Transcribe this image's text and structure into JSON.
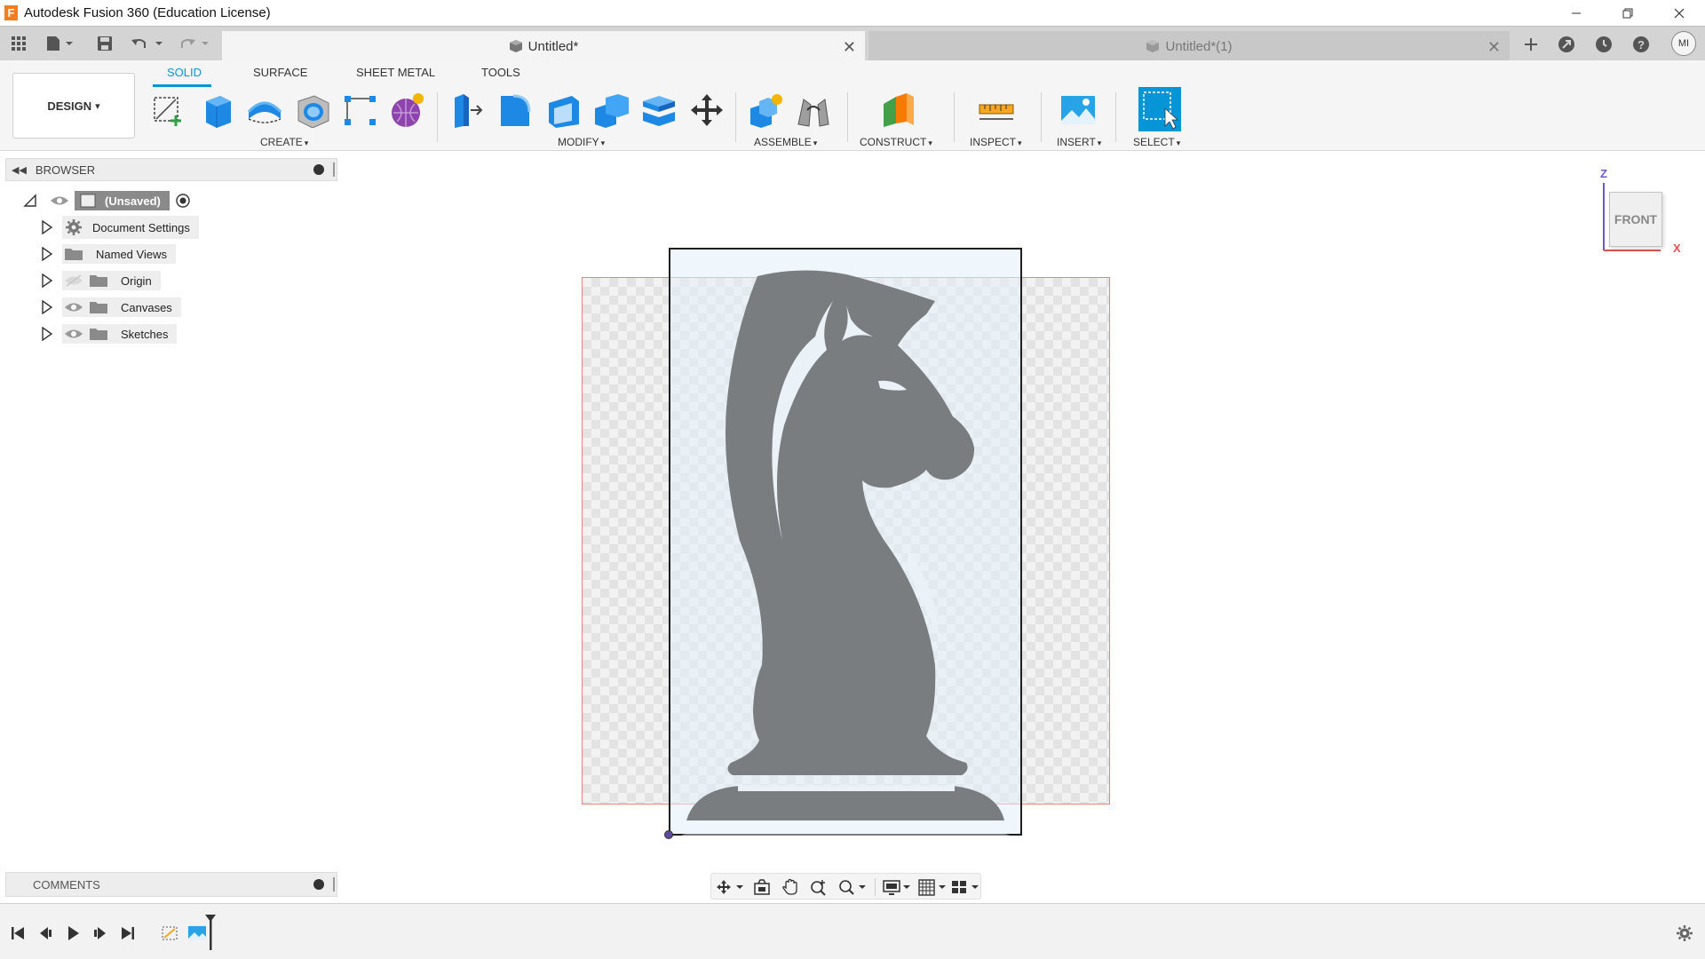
{
  "window": {
    "title": "Autodesk Fusion 360 (Education License)",
    "logo_letter": "F"
  },
  "tabs": [
    {
      "label": "Untitled*",
      "active": true
    },
    {
      "label": "Untitled*(1)",
      "active": false
    }
  ],
  "user": {
    "initials": "MI"
  },
  "toolbar": {
    "workspace_button": "DESIGN",
    "workspace_tabs": [
      "SOLID",
      "SURFACE",
      "SHEET METAL",
      "TOOLS"
    ],
    "active_tab": "SOLID",
    "groups": {
      "create": "CREATE",
      "modify": "MODIFY",
      "assemble": "ASSEMBLE",
      "construct": "CONSTRUCT",
      "inspect": "INSPECT",
      "insert": "INSERT",
      "select": "SELECT"
    },
    "dropdown_glyph": "▾"
  },
  "browser": {
    "title": "BROWSER",
    "root": "(Unsaved)",
    "items": [
      {
        "label": "Document Settings",
        "icon": "gear-icon"
      },
      {
        "label": "Named Views",
        "icon": "folder-icon"
      },
      {
        "label": "Origin",
        "icon": "folder-icon",
        "visible": false
      },
      {
        "label": "Canvases",
        "icon": "folder-icon",
        "visible": true
      },
      {
        "label": "Sketches",
        "icon": "folder-icon",
        "visible": true
      }
    ]
  },
  "viewcube": {
    "face": "FRONT",
    "axis_z": "Z",
    "axis_x": "X"
  },
  "comments": {
    "title": "COMMENTS"
  },
  "colors": {
    "accent": "#0696d7",
    "canvas_border": "#f08080",
    "knight_fill": "#7a7d80",
    "axis_z": "#6a5acd",
    "axis_x": "#e05050"
  }
}
